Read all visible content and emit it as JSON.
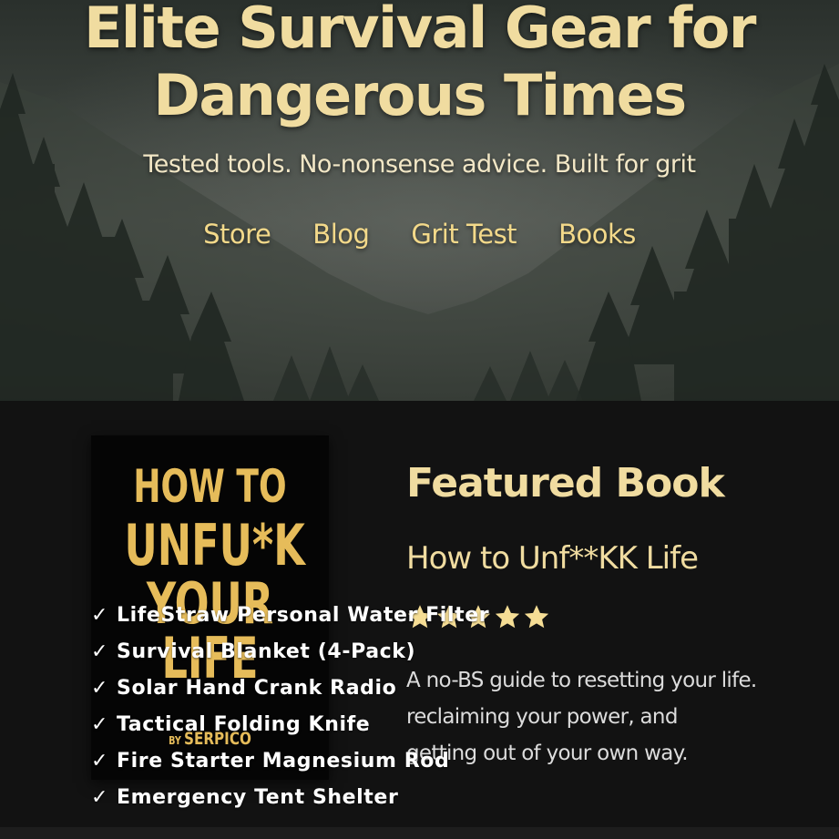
{
  "hero": {
    "title_line1": "Elite Survival Gear for",
    "title_line2": "Dangerous Times",
    "tagline": "Tested tools. No-nonsense advice. Built for grit",
    "background": "misty-forest-valley"
  },
  "nav": {
    "items": [
      {
        "label": "Store"
      },
      {
        "label": "Blog"
      },
      {
        "label": "Grit Test"
      },
      {
        "label": "Books"
      }
    ]
  },
  "featured": {
    "heading": "Featured Book",
    "book_title": "How to Unf**KK Life",
    "rating": 5,
    "description_line1": "A no-BS guide to resetting your life.",
    "description_line2": "reclaiming your power, and",
    "description_line3": "getting out of your own way.",
    "cover": {
      "line1": "HOW TO",
      "line2": "UNFU*K",
      "line3": "YOUR",
      "line4": "LIFE",
      "by": "BY",
      "author": "SERPICO"
    }
  },
  "products": {
    "check_glyph": "✓",
    "items": [
      "LifeStraw Personal Water Filter",
      "Survival Blanket (4-Pack)",
      "Solar Hand Crank Radio",
      "Tactical Folding Knife",
      "Fire Starter Magnesium Rod",
      "Emergency Tent Shelter"
    ]
  },
  "colors": {
    "accent_gold": "#f0dca0",
    "nav_gold": "#f3d98a",
    "cover_gold": "#e6bc5a",
    "star": "#f5dd95",
    "section_bg": "#121212"
  }
}
